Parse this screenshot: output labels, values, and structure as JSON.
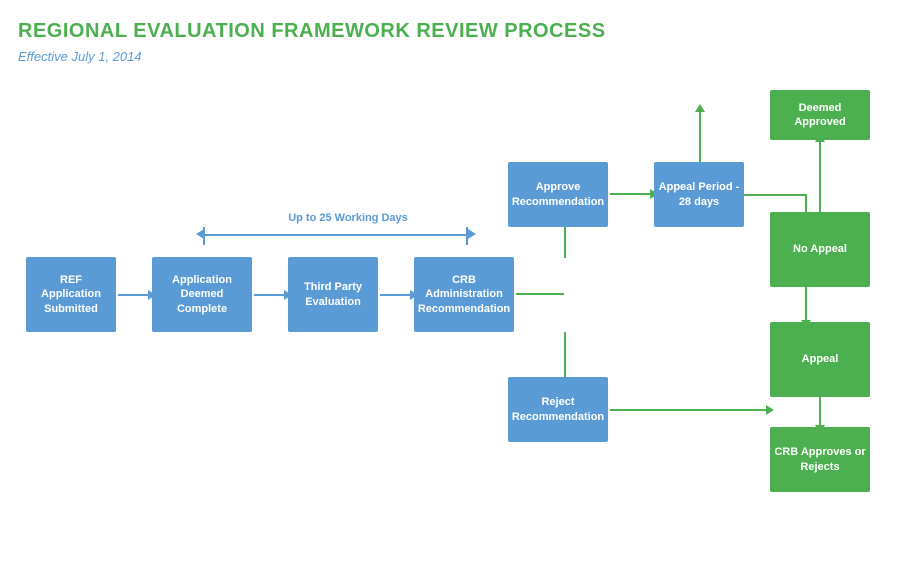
{
  "title": "REGIONAL EVALUATION FRAMEWORK REVIEW PROCESS",
  "subtitle": "Effective July 1, 2014",
  "boxes": {
    "ref_application": "REF Application Submitted",
    "app_deemed": "Application Deemed Complete",
    "third_party": "Third Party Evaluation",
    "crb_admin": "CRB Administration Recommendation",
    "approve_rec": "Approve Recommendation",
    "reject_rec": "Reject Recommendation",
    "appeal_period": "Appeal Period - 28 days",
    "no_appeal": "No Appeal",
    "appeal": "Appeal",
    "deemed_approved": "Deemed Approved",
    "crb_approves": "CRB Approves or Rejects"
  },
  "labels": {
    "working_days": "Up to 25 Working Days"
  },
  "colors": {
    "blue": "#5b9bd5",
    "green": "#4CAF50",
    "title_green": "#4CAF50"
  }
}
